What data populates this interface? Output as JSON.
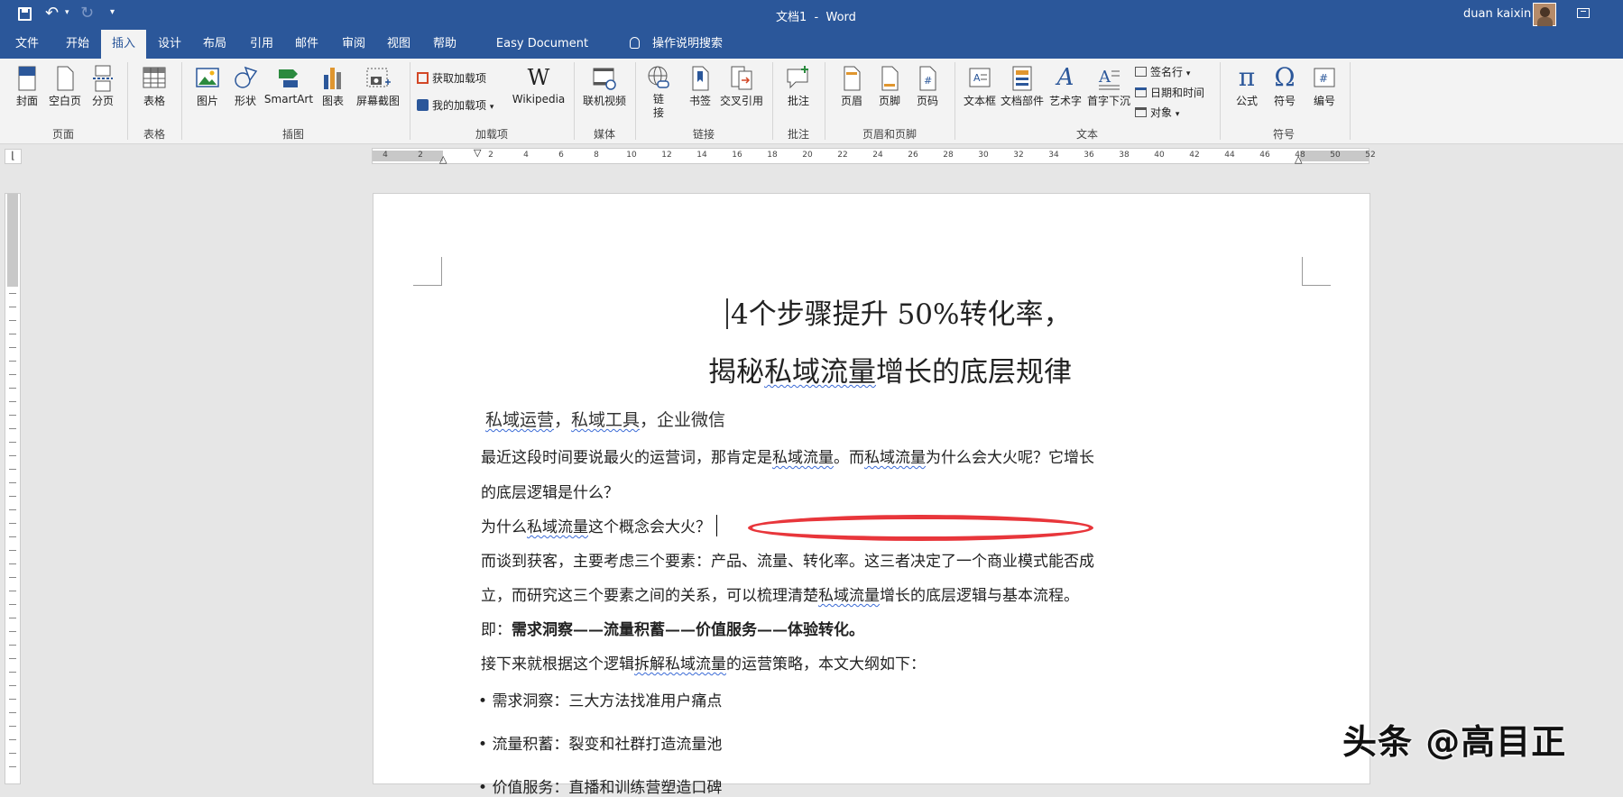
{
  "title": "文档1  -  Word",
  "user": "duan kaixin",
  "tabs": [
    "文件",
    "开始",
    "插入",
    "设计",
    "布局",
    "引用",
    "邮件",
    "审阅",
    "视图",
    "帮助",
    "Easy Document Creator"
  ],
  "tell_me": "操作说明搜索",
  "ribbon": {
    "pages": {
      "cover": "封面",
      "blank": "空白页",
      "break": "分页",
      "group": "页面"
    },
    "tables": {
      "table": "表格",
      "group": "表格"
    },
    "illus": {
      "picture": "图片",
      "shapes": "形状",
      "smartart": "SmartArt",
      "chart": "图表",
      "screenshot": "屏幕截图",
      "group": "插图"
    },
    "addins": {
      "get": "获取加载项",
      "mine": "我的加载项",
      "wiki": "Wikipedia",
      "group": "加载项"
    },
    "media": {
      "video": "联机视频",
      "group": "媒体"
    },
    "links": {
      "link": "链\n接",
      "bookmark": "书签",
      "crossref": "交叉引用",
      "group": "链接"
    },
    "comments": {
      "comment": "批注",
      "group": "批注"
    },
    "hf": {
      "header": "页眉",
      "footer": "页脚",
      "pagenum": "页码",
      "group": "页眉和页脚"
    },
    "text": {
      "textbox": "文本框",
      "parts": "文档部件",
      "wordart": "艺术字",
      "dropcap": "首字下沉",
      "sig": "签名行",
      "datetime": "日期和时间",
      "object": "对象",
      "group": "文本"
    },
    "symbols": {
      "equation": "公式",
      "symbol": "符号",
      "number": "编号",
      "group": "符号"
    }
  },
  "ruler_numbers": [
    "4",
    "2",
    "",
    "2",
    "4",
    "6",
    "8",
    "10",
    "12",
    "14",
    "16",
    "18",
    "20",
    "22",
    "24",
    "26",
    "28",
    "30",
    "32",
    "34",
    "36",
    "38",
    "40",
    "42",
    "44",
    "46",
    "48",
    "50",
    "52"
  ],
  "doc": {
    "title1": "4个步骤提升 50%转化率，",
    "title2a": "揭秘",
    "title2b": "私域流量",
    "title2c": "增长的底层规律",
    "keywords": {
      "a": "私域运营",
      "sep1": "，",
      "b": "私域工具",
      "sep2": "，企业微信"
    },
    "p1a": "最近这段时间要说最火的运营词，那肯定是",
    "p1b": "私域流量",
    "p1c": "。而",
    "p1d": "私域流量",
    "p1e": "为什么会大火呢？它增长",
    "p1f": "的底层逻辑是什么？",
    "p2a": "为什么",
    "p2b": "私域流量",
    "p2c": "这个概念会大火？",
    "p3a": "而谈到获客，主要考虑三个要素：产品、流量、转化率。这三者决定了一个商业模式能否成",
    "p3b": "立，而研究这三个要素之间的关系，可以梳理清楚",
    "p3c": "私域流量",
    "p3d": "增长的底层逻辑与基本流程。",
    "p4a": "即：",
    "p4b": "需求洞察——流量积蓄——价值服务——体验转化。",
    "p5a": "接下来就根据这个逻辑",
    "p5b": "拆解私域流量",
    "p5c": "的运营策略，本文大纲如下：",
    "b1": "需求洞察：三大方法找准用户痛点",
    "b2": "流量积蓄：裂变和社群打造流量池",
    "b3": "价值服务：直播和训练营塑造口碑"
  },
  "watermark": "头条 @高目正",
  "colors": {
    "brand": "#2b579a",
    "annotation": "#e8363b"
  }
}
